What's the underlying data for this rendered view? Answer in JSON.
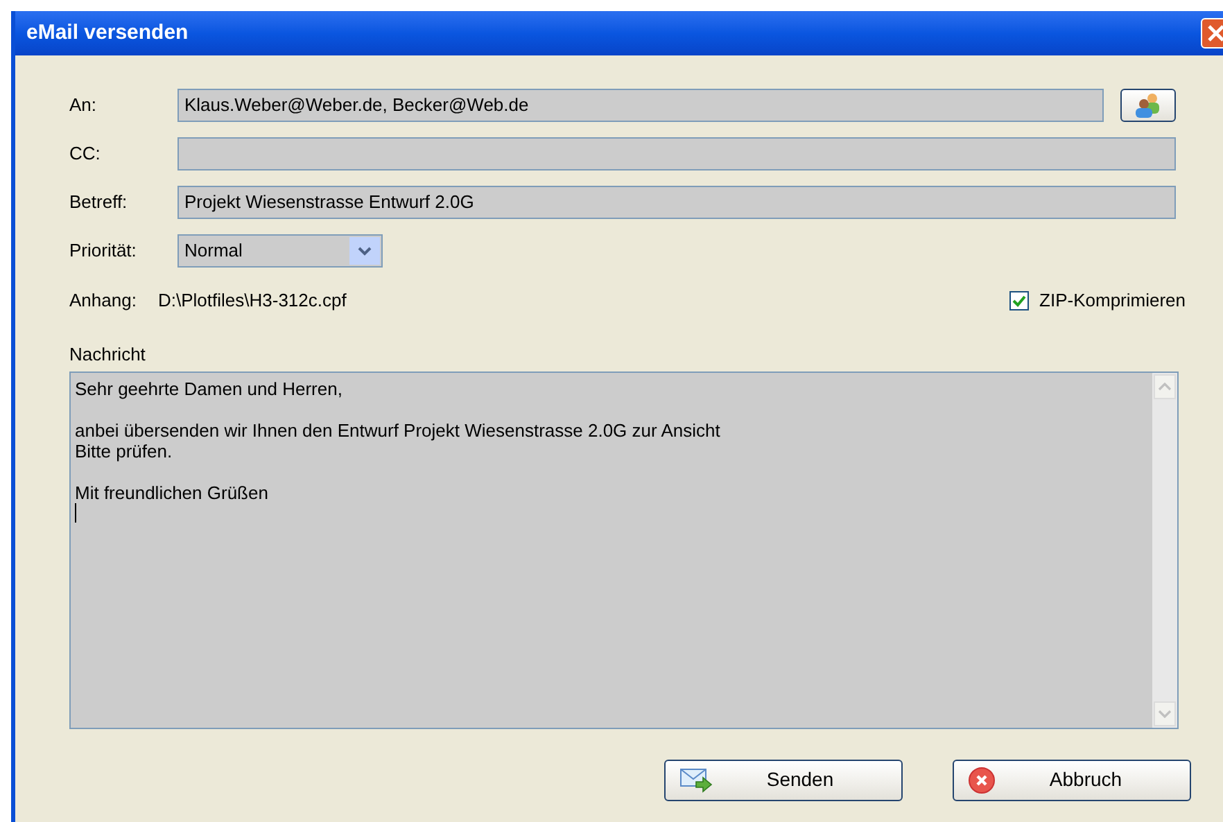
{
  "window": {
    "title": "eMail versenden"
  },
  "fields": [
    {
      "label": "An:",
      "value": "Klaus.Weber@Weber.de, Becker@Web.de",
      "address_book": true
    },
    {
      "label": "CC:",
      "address_book": false
    },
    {
      "label": "Betreff:",
      "value": "Projekt Wiesenstrasse Entwurf 2.0G",
      "address_book": false
    }
  ],
  "priority": {
    "label": "Priorität:",
    "value": "Normal"
  },
  "attachment": {
    "label": "Anhang:",
    "path": "D:\\Plotfiles\\H3-312c.cpf"
  },
  "zip": {
    "label": "ZIP-Komprimieren",
    "checked": true
  },
  "message": {
    "label": "Nachricht",
    "text": "Sehr geehrte Damen und Herren,\n\nanbei übersenden wir Ihnen den Entwurf Projekt Wiesenstrasse 2.0G zur Ansicht\nBitte prüfen.\n\nMit freundlichen Grüßen"
  },
  "buttons": [
    {
      "kind": "send",
      "label": "Senden"
    },
    {
      "kind": "cancel",
      "label": "Abbruch"
    }
  ]
}
